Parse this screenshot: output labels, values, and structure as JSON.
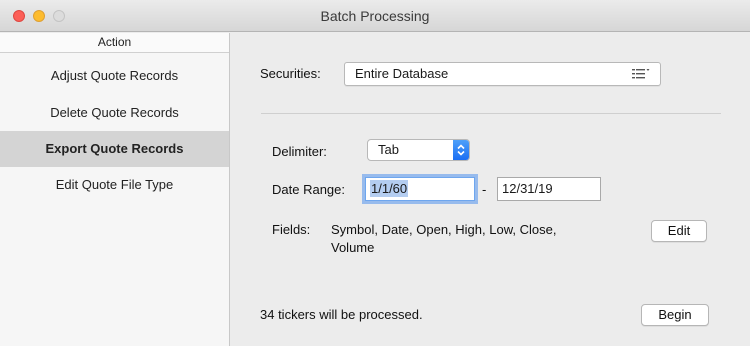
{
  "window": {
    "title": "Batch Processing"
  },
  "sidebar": {
    "header": "Action",
    "items": [
      {
        "label": "Adjust Quote Records"
      },
      {
        "label": "Delete Quote Records"
      },
      {
        "label": "Export Quote Records",
        "selected": true
      },
      {
        "label": "Edit Quote File Type"
      }
    ]
  },
  "main": {
    "securities_label": "Securities:",
    "securities_value": "Entire Database",
    "delimiter_label": "Delimiter:",
    "delimiter_value": "Tab",
    "date_range_label": "Date Range:",
    "date_start": "1/1/60",
    "date_separator": "-",
    "date_end": "12/31/19",
    "fields_label": "Fields:",
    "fields_line1": "Symbol, Date, Open, High, Low, Close,",
    "fields_line2": "Volume",
    "edit_button": "Edit",
    "status_text": "34 tickers will be processed.",
    "begin_button": "Begin"
  },
  "colors": {
    "accent": "#1a6ef3",
    "selection": "#b4cdf0",
    "close": "#fc5f57",
    "minimize": "#fdbc2e",
    "zoom_disabled": "#dcdcdc",
    "sidebar_selected": "#d4d4d4"
  },
  "icons": {
    "close": "close-icon",
    "minimize": "minimize-icon",
    "zoom": "zoom-icon",
    "securities_menu": "list-menu-icon",
    "delimiter_stepper": "chevron-updown-icon"
  }
}
